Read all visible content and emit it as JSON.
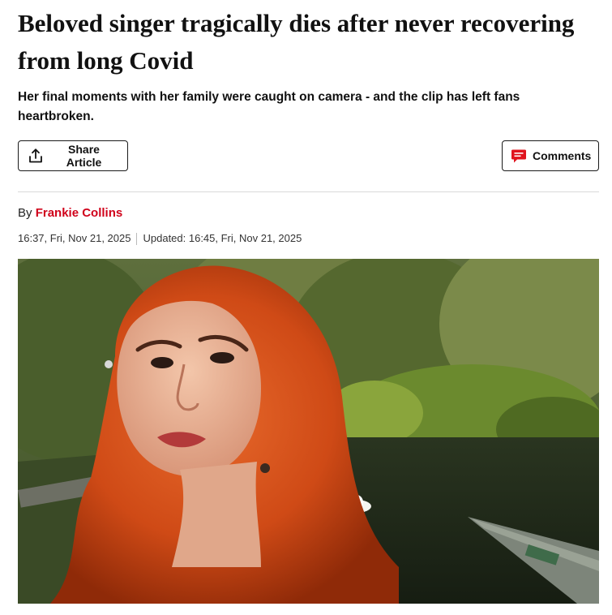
{
  "article": {
    "headline": "Beloved singer tragically dies after never recovering from long Covid",
    "subheadline": "Her final moments with her family were caught on camera - and the clip has left fans heartbroken.",
    "share_label": "Share Article",
    "comments_label": "Comments",
    "by_prefix": "By",
    "author": "Frankie Collins",
    "published": "16:37, Fri, Nov 21, 2025",
    "updated": "Updated: 16:45, Fri, Nov 21, 2025"
  },
  "colors": {
    "accent": "#d0021b",
    "comments_icon": "#e0141e"
  },
  "icons": {
    "share": "share-upload-icon",
    "comments": "speech-bubble-icon"
  }
}
